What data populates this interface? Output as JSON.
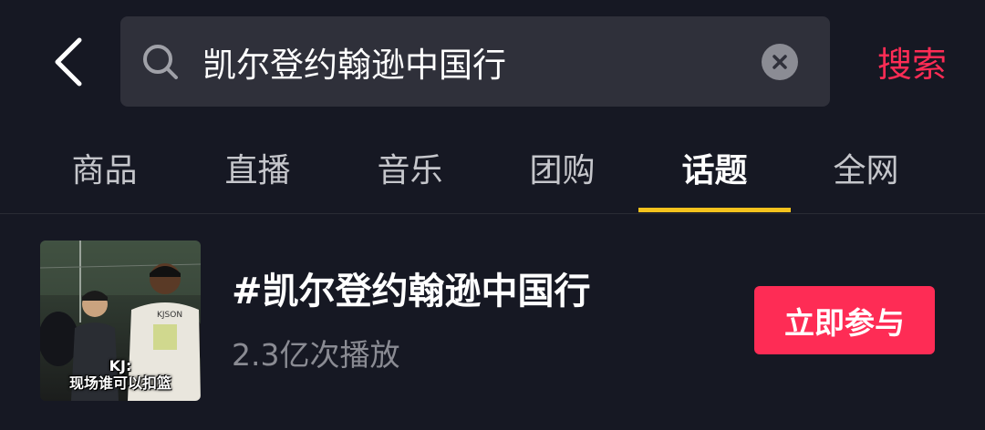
{
  "search": {
    "query": "凯尔登约翰逊中国行",
    "submit_label": "搜索"
  },
  "tabs": [
    {
      "label": "商品",
      "active": false
    },
    {
      "label": "直播",
      "active": false
    },
    {
      "label": "音乐",
      "active": false
    },
    {
      "label": "团购",
      "active": false
    },
    {
      "label": "话题",
      "active": true
    },
    {
      "label": "全网",
      "active": false
    }
  ],
  "result": {
    "title": "#凯尔登约翰逊中国行",
    "plays": "2.3亿次播放",
    "join_label": "立即参与",
    "thumbnail_caption_line1": "KJ:",
    "thumbnail_caption_line2": "现场谁可以扣篮"
  },
  "colors": {
    "background": "#161823",
    "accent": "#fe2c55",
    "tab_indicator": "#f4c21d",
    "search_field": "#2f303a"
  },
  "icons": {
    "back": "chevron-left-icon",
    "search": "search-icon",
    "clear": "clear-icon"
  }
}
